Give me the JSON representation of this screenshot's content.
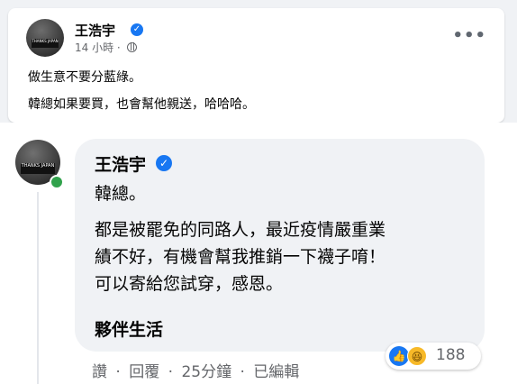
{
  "post": {
    "author": "王浩宇",
    "time": "14 小時",
    "line1": "做生意不要分藍綠。",
    "line2": "韓總如果要買，也會幫他親送，哈哈哈。",
    "avatar_caption": "THANKS JAPAN"
  },
  "comment": {
    "author": "王浩宇",
    "line1": "韓總。",
    "line2": "都是被罷免的同路人，最近疫情嚴重業",
    "line3": "績不好，有機會幫我推銷一下襪子唷！",
    "line4": "可以寄給您試穿，感恩。",
    "signature": "夥伴生活",
    "reaction_count": "188",
    "actions": {
      "like": "讚",
      "reply": "回覆",
      "time": "25分鐘",
      "edited": "已編輯",
      "separator": "·"
    },
    "avatar_caption": "THANKS JAPAN"
  },
  "icons": {
    "verified": "verified-badge-icon",
    "globe": "globe-icon",
    "more": "more-options-icon",
    "like": "like-reaction-icon",
    "haha": "haha-reaction-icon"
  },
  "colors": {
    "accent": "#1877f2",
    "online": "#31a24c",
    "haha": "#f7b928"
  }
}
